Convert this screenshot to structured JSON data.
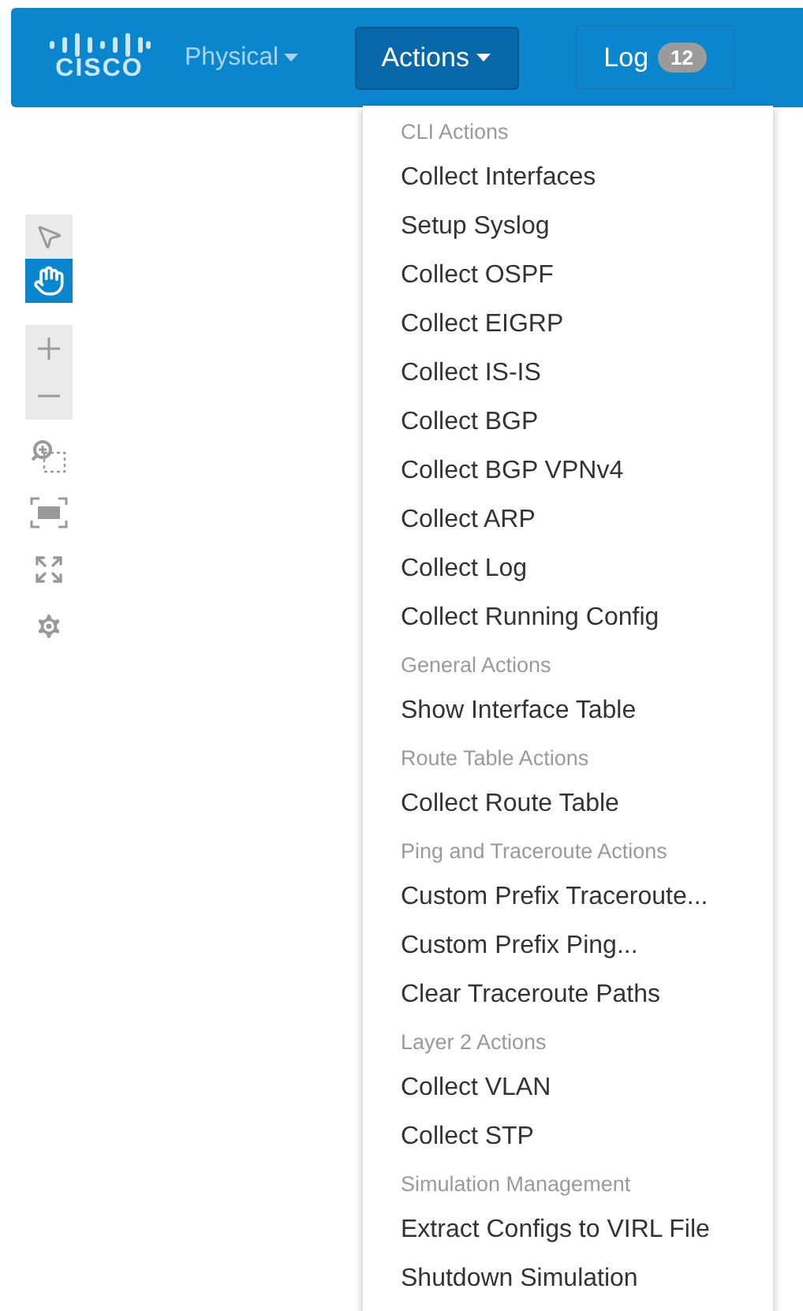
{
  "navbar": {
    "logo": "CISCO",
    "view_menu": {
      "label": "Physical"
    },
    "actions_button": {
      "label": "Actions",
      "open": true
    },
    "log_button": {
      "label": "Log",
      "badge": "12"
    }
  },
  "toolbar": {
    "modes": [
      {
        "kind": "select",
        "selected": false
      },
      {
        "kind": "pan",
        "selected": true
      }
    ],
    "zoom": [
      {
        "kind": "plus"
      },
      {
        "kind": "minus"
      }
    ],
    "tools": [
      {
        "kind": "zoom-area"
      },
      {
        "kind": "fit"
      },
      {
        "kind": "expand"
      },
      {
        "kind": "settings"
      }
    ]
  },
  "actions_menu": [
    {
      "header": "CLI Actions",
      "items": [
        "Collect Interfaces",
        "Setup Syslog",
        "Collect OSPF",
        "Collect EIGRP",
        "Collect IS-IS",
        "Collect BGP",
        "Collect BGP VPNv4",
        "Collect ARP",
        "Collect Log",
        "Collect Running Config"
      ]
    },
    {
      "header": "General Actions",
      "items": [
        "Show Interface Table"
      ]
    },
    {
      "header": "Route Table Actions",
      "items": [
        "Collect Route Table"
      ]
    },
    {
      "header": "Ping and Traceroute Actions",
      "items": [
        "Custom Prefix Traceroute...",
        "Custom Prefix Ping...",
        "Clear Traceroute Paths"
      ]
    },
    {
      "header": "Layer 2 Actions",
      "items": [
        "Collect VLAN",
        "Collect STP"
      ]
    },
    {
      "header": "Simulation Management",
      "items": [
        "Extract Configs to VIRL File",
        "Shutdown Simulation"
      ]
    }
  ]
}
